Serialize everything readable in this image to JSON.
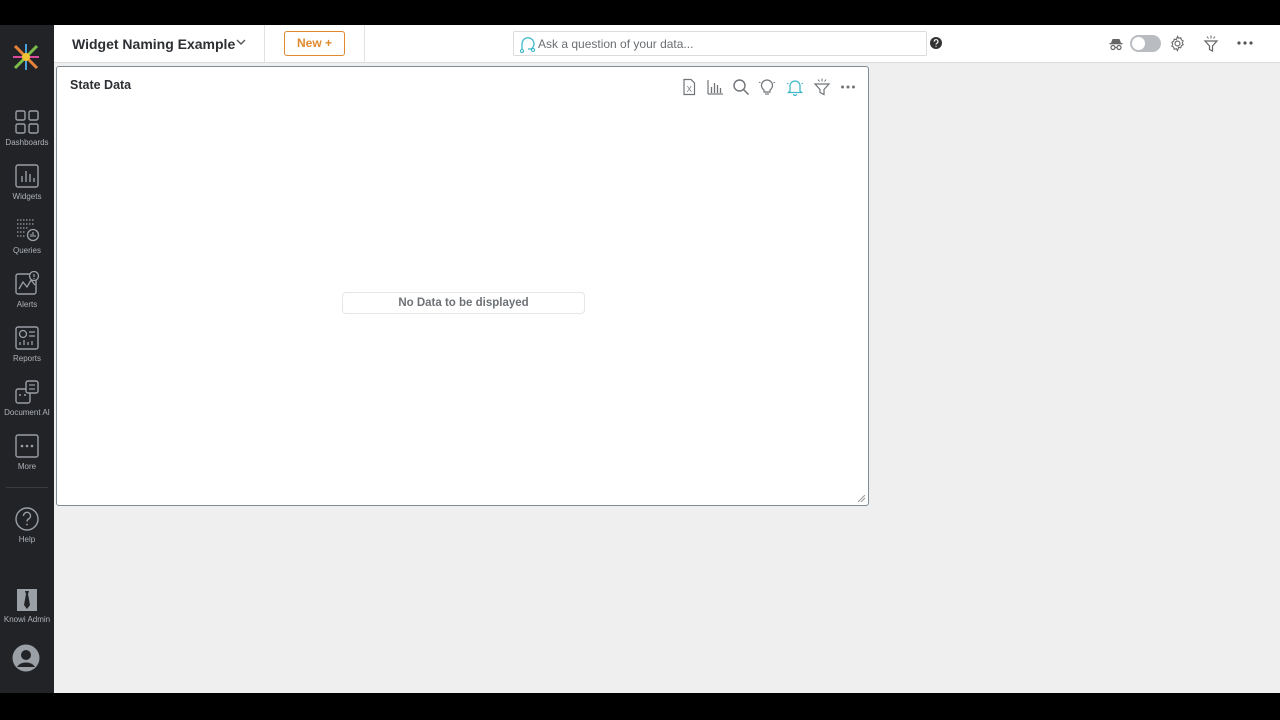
{
  "sidebar": {
    "items": [
      {
        "label": "Dashboards",
        "icon": "dashboards-icon"
      },
      {
        "label": "Widgets",
        "icon": "widgets-icon"
      },
      {
        "label": "Queries",
        "icon": "queries-icon"
      },
      {
        "label": "Alerts",
        "icon": "alerts-icon"
      },
      {
        "label": "Reports",
        "icon": "reports-icon"
      },
      {
        "label": "Document AI",
        "icon": "document-ai-icon"
      },
      {
        "label": "More",
        "icon": "more-icon"
      }
    ],
    "help_label": "Help",
    "account_label": "Knowi Admin"
  },
  "header": {
    "dashboard_title": "Widget Naming Example",
    "new_button_label": "New +",
    "search_placeholder": "Ask a question of your data..."
  },
  "widget": {
    "title": "State Data",
    "empty_message": "No Data to be displayed",
    "toolbar_icons": [
      "export-excel-icon",
      "chart-icon",
      "search-icon",
      "insights-bulb-icon",
      "alert-bell-icon",
      "filter-icon",
      "more-icon"
    ]
  },
  "colors": {
    "accent_orange": "#e08a2e",
    "sidebar_bg": "#222326",
    "canvas_bg": "#efeff0",
    "alert_icon_teal": "#3fb8c9"
  }
}
